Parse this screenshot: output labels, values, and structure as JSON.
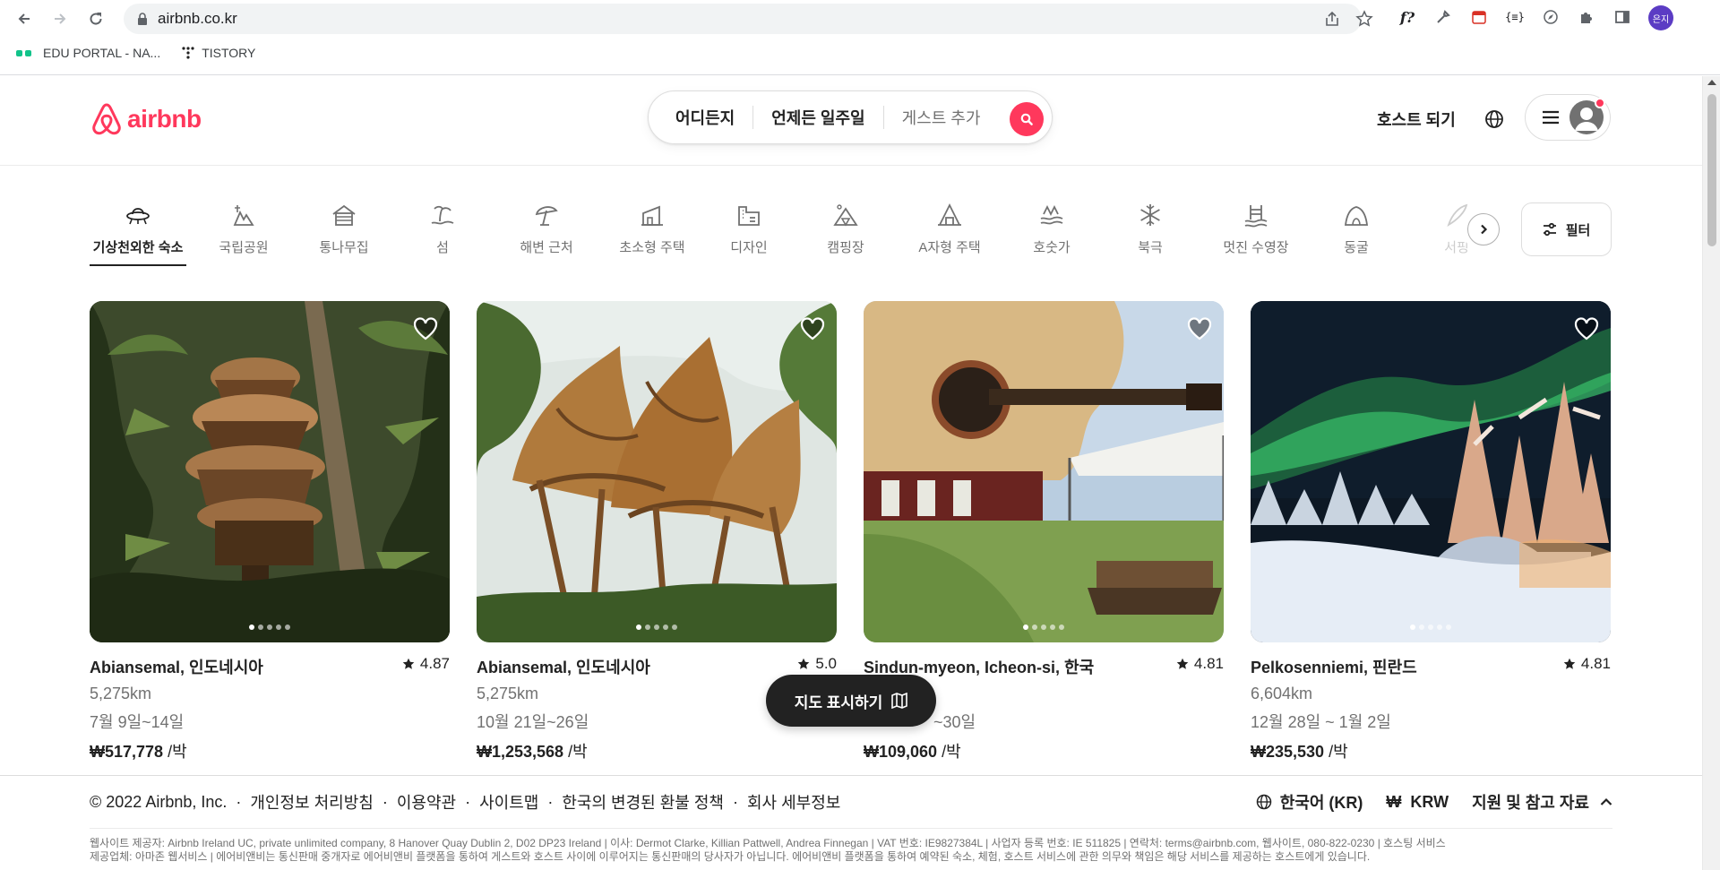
{
  "browser": {
    "url": "airbnb.co.kr",
    "profile_initials": "은지",
    "bookmarks": [
      {
        "label": "EDU PORTAL - NA..."
      },
      {
        "label": "TISTORY"
      }
    ]
  },
  "header": {
    "brand": "airbnb",
    "search": {
      "where": "어디든지",
      "when": "언제든 일주일",
      "guests": "게스트 추가"
    },
    "host_link": "호스트 되기",
    "colors": {
      "brand": "#FF385C",
      "text": "#222222",
      "muted": "#717171"
    }
  },
  "categories": [
    {
      "label": "기상천외한 숙소",
      "icon": "ufo-icon",
      "active": true
    },
    {
      "label": "국립공원",
      "icon": "national-park-icon"
    },
    {
      "label": "통나무집",
      "icon": "cabin-icon"
    },
    {
      "label": "섬",
      "icon": "island-icon"
    },
    {
      "label": "해변 근처",
      "icon": "beach-umbrella-icon"
    },
    {
      "label": "초소형 주택",
      "icon": "tiny-home-icon"
    },
    {
      "label": "디자인",
      "icon": "design-icon"
    },
    {
      "label": "캠핑장",
      "icon": "camping-icon"
    },
    {
      "label": "A자형 주택",
      "icon": "a-frame-icon"
    },
    {
      "label": "호숫가",
      "icon": "lake-icon"
    },
    {
      "label": "북극",
      "icon": "arctic-snowflake-icon"
    },
    {
      "label": "멋진 수영장",
      "icon": "pool-icon"
    },
    {
      "label": "동굴",
      "icon": "cave-icon"
    },
    {
      "label": "서핑",
      "icon": "surfing-icon",
      "faded": true
    }
  ],
  "filter_label": "필터",
  "listings": [
    {
      "location": "Abiansemal, 인도네시아",
      "rating": "4.87",
      "distance": "5,275km",
      "dates": "7월 9일~14일",
      "price": "₩517,778",
      "per": " /박"
    },
    {
      "location": "Abiansemal, 인도네시아",
      "rating": "5.0",
      "distance": "5,275km",
      "dates": "10월 21일~26일",
      "price": "₩1,253,568",
      "per": " /박"
    },
    {
      "location": "Sindun-myeon, Icheon-si, 한국",
      "rating": "4.81",
      "distance": "",
      "dates": "~30일",
      "price": "₩109,060",
      "per": " /박"
    },
    {
      "location": "Pelkosenniemi, 핀란드",
      "rating": "4.81",
      "distance": "6,604km",
      "dates": "12월 28일 ~ 1월 2일",
      "price": "₩235,530",
      "per": " /박"
    }
  ],
  "map_button": "지도 표시하기",
  "footer": {
    "links": [
      "© 2022 Airbnb, Inc.",
      "개인정보 처리방침",
      "이용약관",
      "사이트맵",
      "한국의 변경된 환불 정책",
      "회사 세부정보"
    ],
    "language": "한국어 (KR)",
    "currency_symbol": "₩",
    "currency": "KRW",
    "support": "지원 및 참고 자료",
    "legal_1": "웹사이트 제공자: Airbnb Ireland UC, private unlimited company, 8 Hanover Quay Dublin 2, D02 DP23 Ireland | 이사: Dermot Clarke, Killian Pattwell, Andrea Finnegan | VAT 번호: IE9827384L | 사업자 등록 번호: IE 511825 | 연락처: terms@airbnb.com, 웹사이트, 080-822-0230 | 호스팅 서비스",
    "legal_2": "제공업체: 아마존 웹서비스 | 에어비앤비는 통신판매 중개자로 에어비앤비 플랫폼을 통하여 게스트와 호스트 사이에 이루어지는 통신판매의 당사자가 아닙니다. 에어비앤비 플랫폼을 통하여 예약된 숙소, 체험, 호스트 서비스에 관한 의무와 책임은 해당 서비스를 제공하는 호스트에게 있습니다."
  }
}
